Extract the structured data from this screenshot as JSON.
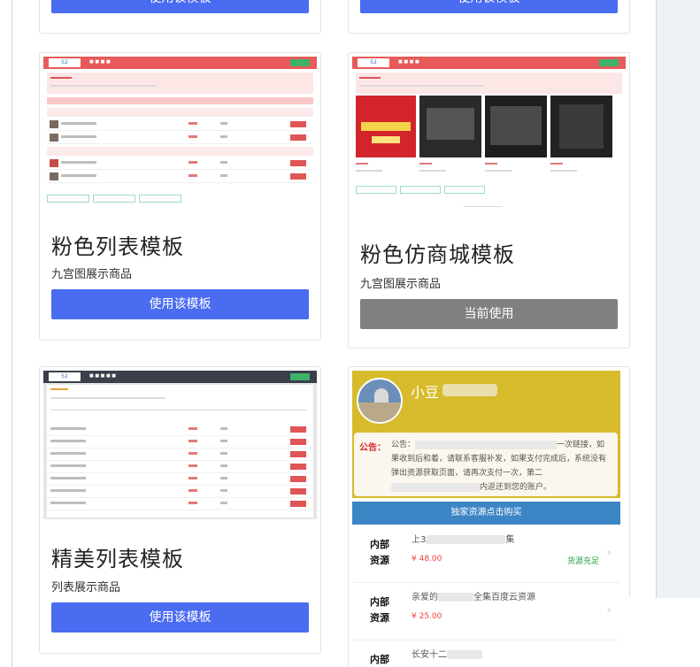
{
  "top_row": {
    "left_button": "使用该模板",
    "right_button": "使用该模板"
  },
  "templates": [
    {
      "title": "粉色列表模板",
      "subtitle": "九宫图展示商品",
      "button": "使用该模板",
      "button_state": "active"
    },
    {
      "title": "粉色仿商城模板",
      "subtitle": "九宫图展示商品",
      "button": "当前使用",
      "button_state": "current"
    },
    {
      "title": "精美列表模板",
      "subtitle": "列表展示商品",
      "button": "使用该模板",
      "button_state": "active"
    }
  ],
  "mobile_preview": {
    "name": "小豆",
    "notice_label": "公告：",
    "notice_text_1": "公告：",
    "notice_text_2": "一次链接，如果收到后和着，请联系客服补发，如果支付完成后，系统没有弹出资源获取页面，请再次支付一次，第二",
    "notice_text_3": "内返还到您的账户。",
    "buy_bar": "独家资源点击购买",
    "items": [
      {
        "tag": "内部资源",
        "title": "上3",
        "title_tail": "集",
        "price": "¥ 48.00",
        "stock": "货源充足"
      },
      {
        "tag": "内部资源",
        "title": "亲爱的",
        "title_tail": "全集百度云资源",
        "price": "¥ 25.00",
        "stock": ""
      },
      {
        "tag": "内部",
        "title": "长安十二",
        "title_tail": "",
        "price": "",
        "stock": ""
      }
    ]
  },
  "colors": {
    "blue_button": "#4a6cf0",
    "grey_button": "#808080",
    "pink_header": "#e85a5a",
    "mobile_yellow": "#d7bb2c",
    "mobile_bar": "#3d86c6"
  }
}
